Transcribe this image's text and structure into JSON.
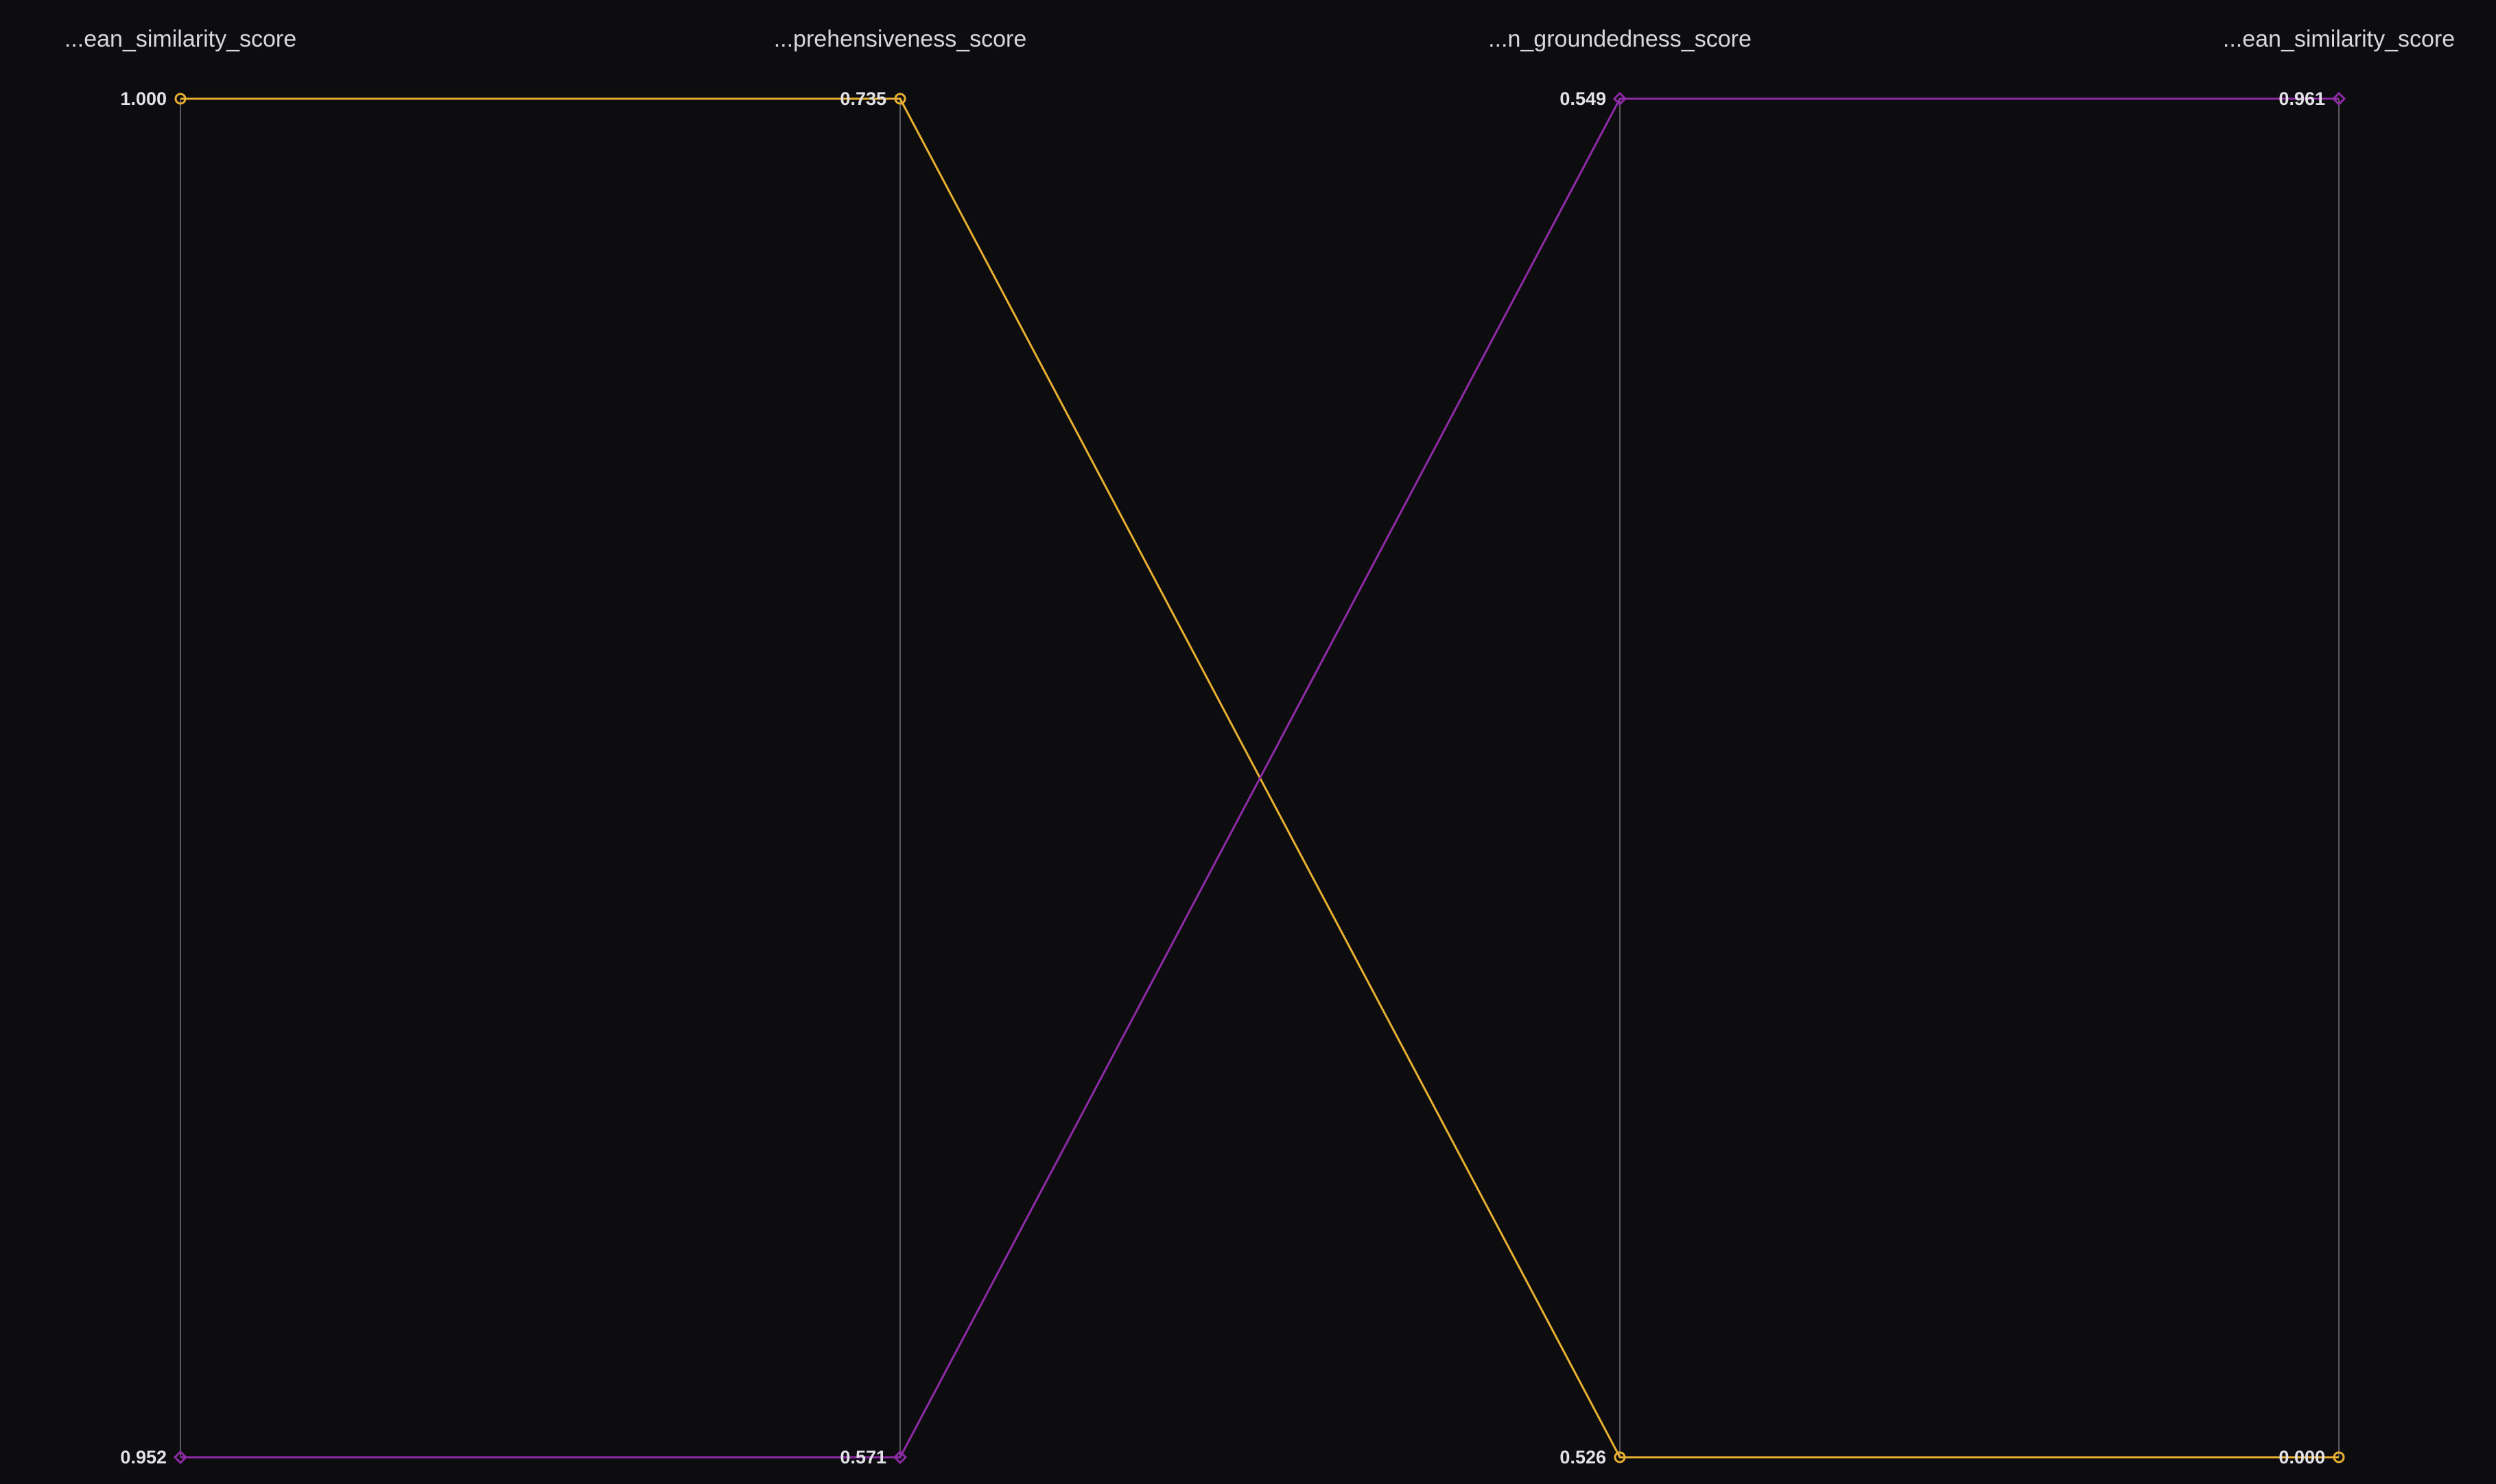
{
  "chart_data": {
    "type": "parallel_coordinates",
    "axes": [
      {
        "label": "...ean_similarity_score",
        "max": 1.0,
        "min": 0.952,
        "max_label": "1.000",
        "min_label": "0.952"
      },
      {
        "label": "...prehensiveness_score",
        "max": 0.735,
        "min": 0.571,
        "max_label": "0.735",
        "min_label": "0.571"
      },
      {
        "label": "...n_groundedness_score",
        "max": 0.549,
        "min": 0.526,
        "max_label": "0.549",
        "min_label": "0.526"
      },
      {
        "label": "...ean_similarity_score",
        "max": 0.961,
        "min": 0.0,
        "max_label": "0.961",
        "min_label": "0.000"
      }
    ],
    "series": [
      {
        "color": "#e8b030",
        "marker": "circle",
        "values": [
          1.0,
          0.735,
          0.526,
          0.0
        ]
      },
      {
        "color": "#8e2aa6",
        "marker": "diamond",
        "values": [
          0.952,
          0.571,
          0.549,
          0.961
        ]
      }
    ],
    "grid": false,
    "legend": "none"
  },
  "colors": {
    "background": "#0d0d0f",
    "axis": "#5a5a60",
    "text": "#e2e2e6"
  }
}
